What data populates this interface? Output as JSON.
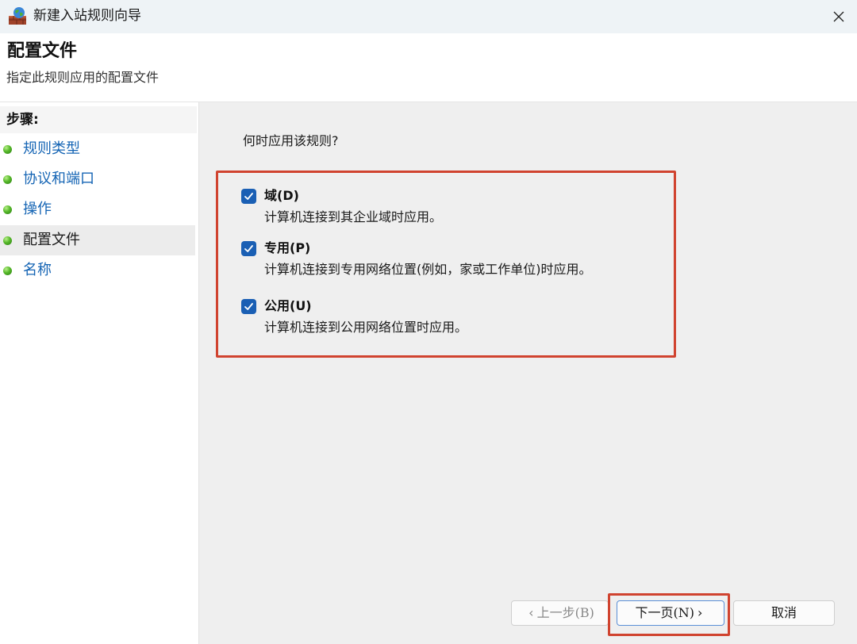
{
  "window": {
    "title": "新建入站规则向导",
    "close_icon": "close-icon",
    "app_icon": "firewall-globe-icon"
  },
  "header": {
    "title": "配置文件",
    "subtitle": "指定此规则应用的配置文件"
  },
  "sidebar": {
    "steps_label": "步骤:",
    "items": [
      {
        "label": "规则类型",
        "active": false
      },
      {
        "label": "协议和端口",
        "active": false
      },
      {
        "label": "操作",
        "active": false
      },
      {
        "label": "配置文件",
        "active": true
      },
      {
        "label": "名称",
        "active": false
      }
    ]
  },
  "main": {
    "question": "何时应用该规则?",
    "options": [
      {
        "label": "域(D)",
        "description": "计算机连接到其企业域时应用。",
        "checked": true
      },
      {
        "label": "专用(P)",
        "description": "计算机连接到专用网络位置(例如，家或工作单位)时应用。",
        "checked": true
      },
      {
        "label": "公用(U)",
        "description": "计算机连接到公用网络位置时应用。",
        "checked": true
      }
    ]
  },
  "footer": {
    "back_label": "上一步(B)",
    "next_label": "下一页(N)",
    "cancel_label": "取消",
    "back_chevron": "‹",
    "next_chevron": "›"
  },
  "colors": {
    "link": "#1464b4",
    "checkbox": "#1a5fb4",
    "highlight": "#d0432f",
    "content_bg": "#efefef"
  }
}
